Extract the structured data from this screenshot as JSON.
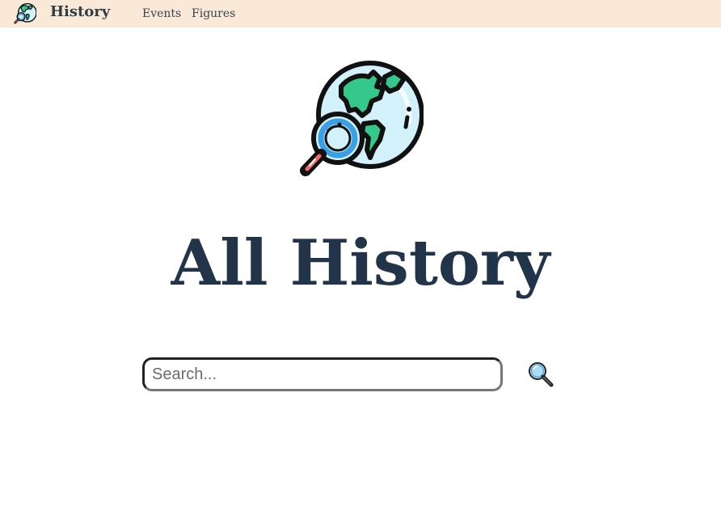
{
  "navbar": {
    "logo_icon": "globe-magnifier-icon",
    "brand": "History",
    "links": [
      {
        "label": "Events"
      },
      {
        "label": "Figures"
      }
    ],
    "background_color": "#fae9d6"
  },
  "hero": {
    "logo_icon": "globe-magnifier-icon",
    "title": "All History",
    "title_color": "#22344a"
  },
  "search": {
    "placeholder": "Search...",
    "value": "",
    "button_icon": "magnifier-icon"
  }
}
